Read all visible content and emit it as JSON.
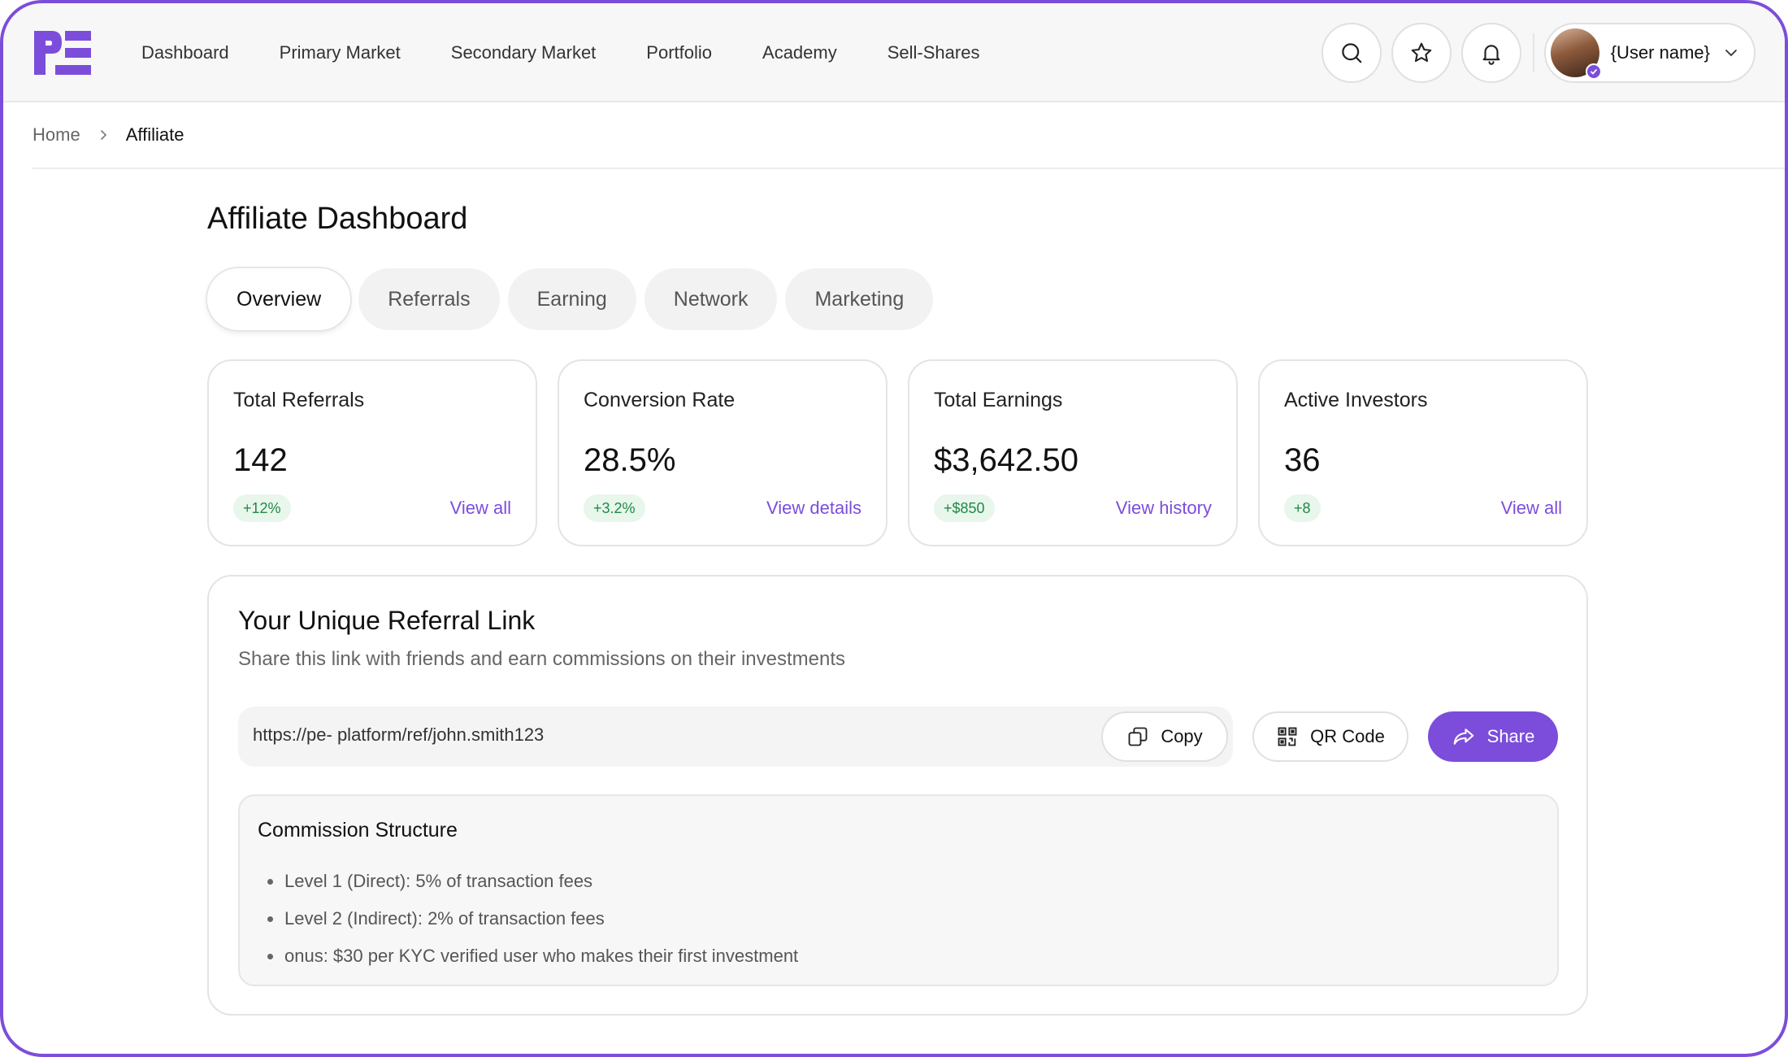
{
  "brand": {
    "accent": "#7c4ddb",
    "success_bg": "#e8f6ec",
    "success_fg": "#1f8a45"
  },
  "nav": {
    "items": [
      "Dashboard",
      "Primary Market",
      "Secondary Market",
      "Portfolio",
      "Academy",
      "Sell-Shares"
    ],
    "icons": [
      "search-icon",
      "star-icon",
      "bell-icon"
    ],
    "user_name": "{User name}"
  },
  "breadcrumb": {
    "home": "Home",
    "current": "Affiliate"
  },
  "page": {
    "title": "Affiliate Dashboard",
    "tabs": [
      "Overview",
      "Referrals",
      "Earning",
      "Network",
      "Marketing"
    ],
    "active_tab": "Overview"
  },
  "stats": [
    {
      "label": "Total Referrals",
      "value": "142",
      "delta": "+12%",
      "link": "View all"
    },
    {
      "label": "Conversion Rate",
      "value": "28.5%",
      "delta": "+3.2%",
      "link": "View details"
    },
    {
      "label": "Total Earnings",
      "value": "$3,642.50",
      "delta": "+$850",
      "link": "View history"
    },
    {
      "label": "Active Investors",
      "value": "36",
      "delta": "+8",
      "link": "View all"
    }
  ],
  "referral": {
    "title": "Your Unique Referral Link",
    "subtitle": "Share this link with friends and earn commissions on their investments",
    "link": "https://pe- platform/ref/john.smith123",
    "copy_label": "Copy",
    "qr_label": "QR Code",
    "share_label": "Share"
  },
  "commission": {
    "title": "Commission Structure",
    "items": [
      "Level 1 (Direct): 5% of transaction fees",
      "Level 2 (Indirect): 2% of transaction fees",
      "onus: $30 per KYC verified user who makes their first investment"
    ]
  }
}
